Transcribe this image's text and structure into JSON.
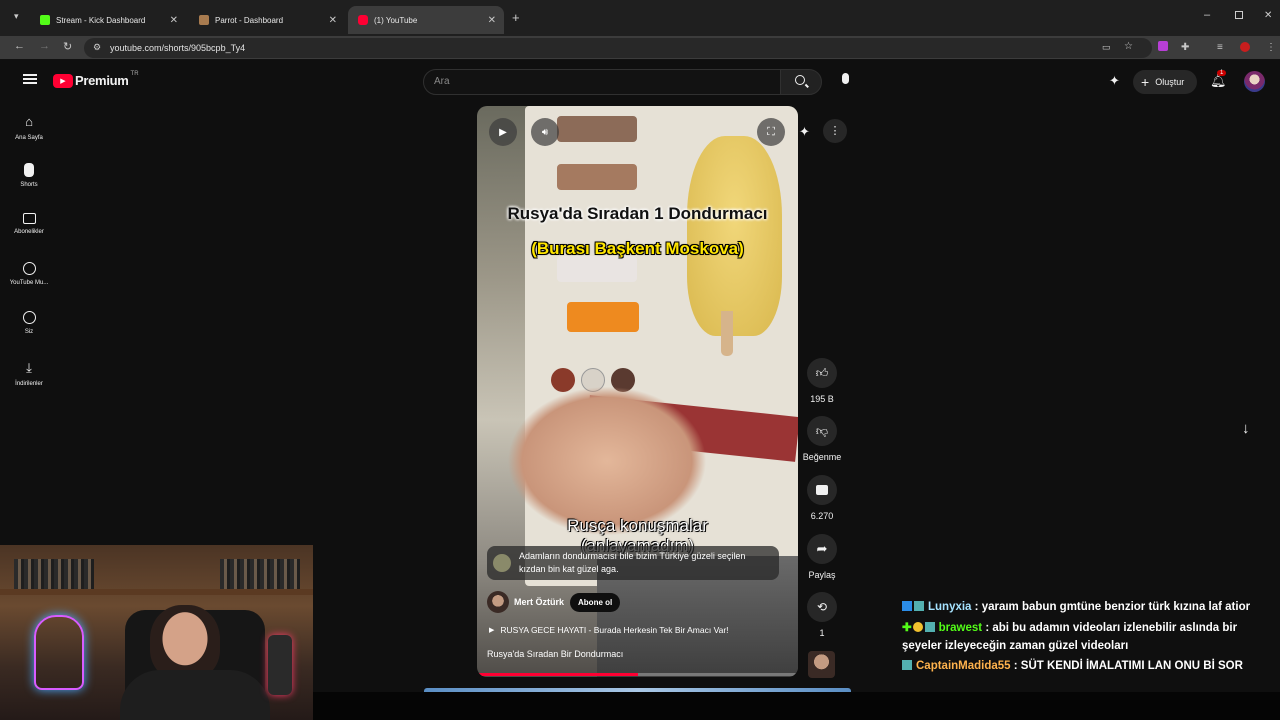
{
  "browser": {
    "tabs": [
      {
        "title": "Stream - Kick Dashboard",
        "favicon_color": "#53fc18"
      },
      {
        "title": "Parrot - Dashboard",
        "favicon_color": "#a87b4f"
      },
      {
        "title": "(1) YouTube",
        "favicon_color": "#ff0033"
      }
    ],
    "url": "youtube.com/shorts/905bcpb_Ty4"
  },
  "youtube": {
    "logo_text": "Premium",
    "region": "TR",
    "search_placeholder": "Ara",
    "create_label": "Oluştur",
    "notification_count": "1",
    "sidebar": [
      {
        "label": "Ana Sayfa",
        "icon": "home-icon"
      },
      {
        "label": "Shorts",
        "icon": "shorts-icon"
      },
      {
        "label": "Abonelikler",
        "icon": "subscriptions-icon"
      },
      {
        "label": "YouTube Mu...",
        "icon": "youtube-music-icon"
      },
      {
        "label": "Siz",
        "icon": "you-icon"
      },
      {
        "label": "İndirilenler",
        "icon": "downloads-icon"
      }
    ]
  },
  "short": {
    "caption_title": "Rusya'da Sıradan 1 Dondurmacı",
    "caption_sub": "(Burası Başkent Moskova)",
    "caption_bottom1": "Rusça konuşmalar",
    "caption_bottom2": "(anlayamadım)",
    "comment_text": "Adamların dondurmacısı bile bizim Türkiye güzeli seçilen kızdan bin kat güzel aga.",
    "channel": "Mert Öztürk",
    "subscribe_label": "Abone ol",
    "playlist": "RUSYA GECE HAYATI - Burada Herkesin Tek Bir Amacı Var!",
    "title": "Rusya'da Sıradan Bir Dondurmacı",
    "likes": "195 B",
    "dislike_label": "Beğenme",
    "comments": "6.270",
    "share_label": "Paylaş",
    "remix_count": "1"
  },
  "chat": [
    {
      "user": "Lunyxia",
      "color": "#a6e3ff",
      "message": ": yaraım babun gmtüne benzior türk kızına laf atior"
    },
    {
      "user": "brawest",
      "color": "#53fc18",
      "message": ": abi bu adamın videoları izlenebilir aslında bir şeyeler izleyeceğin zaman güzel videoları"
    },
    {
      "user": "CaptainMadida55",
      "color": "#ffb34d",
      "message": ": SÜT KENDİ İMALATIMI LAN ONU Bİ SOR"
    }
  ]
}
